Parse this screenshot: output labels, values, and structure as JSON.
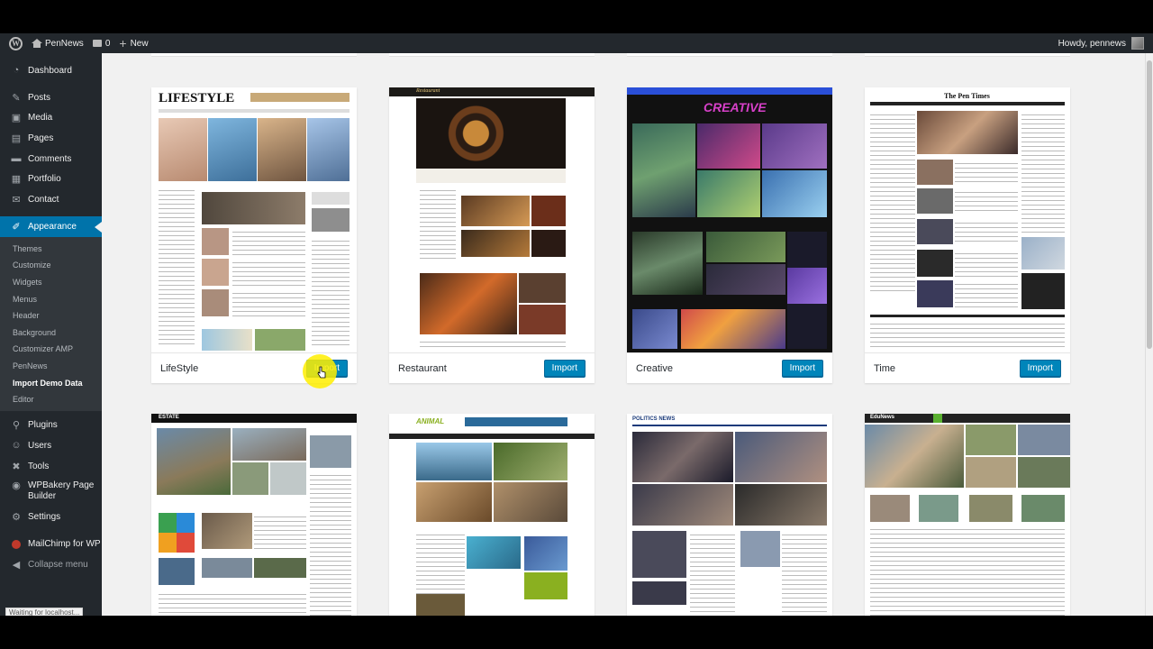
{
  "admin_bar": {
    "site_name": "PenNews",
    "comments_count": "0",
    "new_label": "New",
    "greeting": "Howdy, pennews"
  },
  "sidebar": {
    "items": [
      {
        "label": "Dashboard",
        "icon": "dashboard-icon"
      },
      {
        "label": "Posts",
        "icon": "pin-icon"
      },
      {
        "label": "Media",
        "icon": "media-icon"
      },
      {
        "label": "Pages",
        "icon": "pages-icon"
      },
      {
        "label": "Comments",
        "icon": "comments-icon"
      },
      {
        "label": "Portfolio",
        "icon": "portfolio-icon"
      },
      {
        "label": "Contact",
        "icon": "mail-icon"
      },
      {
        "label": "Appearance",
        "icon": "brush-icon"
      }
    ],
    "appearance_submenu": [
      "Themes",
      "Customize",
      "Widgets",
      "Menus",
      "Header",
      "Background",
      "Customizer AMP",
      "PenNews",
      "Import Demo Data",
      "Editor"
    ],
    "items2": [
      {
        "label": "Plugins",
        "icon": "plugin-icon"
      },
      {
        "label": "Users",
        "icon": "users-icon"
      },
      {
        "label": "Tools",
        "icon": "tools-icon"
      },
      {
        "label": "WPBakery Page Builder",
        "icon": "wpbakery-icon"
      },
      {
        "label": "Settings",
        "icon": "settings-icon"
      },
      {
        "label": "MailChimp for WP",
        "icon": "mailchimp-icon"
      },
      {
        "label": "Collapse menu",
        "icon": "collapse-icon"
      }
    ]
  },
  "demos": [
    {
      "name": "LifeStyle",
      "button": "Import",
      "logo": "LIFESTYLE"
    },
    {
      "name": "Restaurant",
      "button": "Import",
      "logo": "Restaurant"
    },
    {
      "name": "Creative",
      "button": "Import",
      "logo": "CREATIVE"
    },
    {
      "name": "Time",
      "button": "Import",
      "logo": "The Pen Times"
    },
    {
      "logo": "ESTATE"
    },
    {
      "logo": "ANIMAL"
    },
    {
      "logo": "POLITICS NEWS"
    },
    {
      "logo": "EduNews"
    }
  ],
  "status_bar": "Waiting for localhost...",
  "colors": {
    "admin_bar": "#23282d",
    "sidebar": "#23282d",
    "active_menu": "#0073aa",
    "button": "#0085ba",
    "highlight": "#ffee00"
  }
}
